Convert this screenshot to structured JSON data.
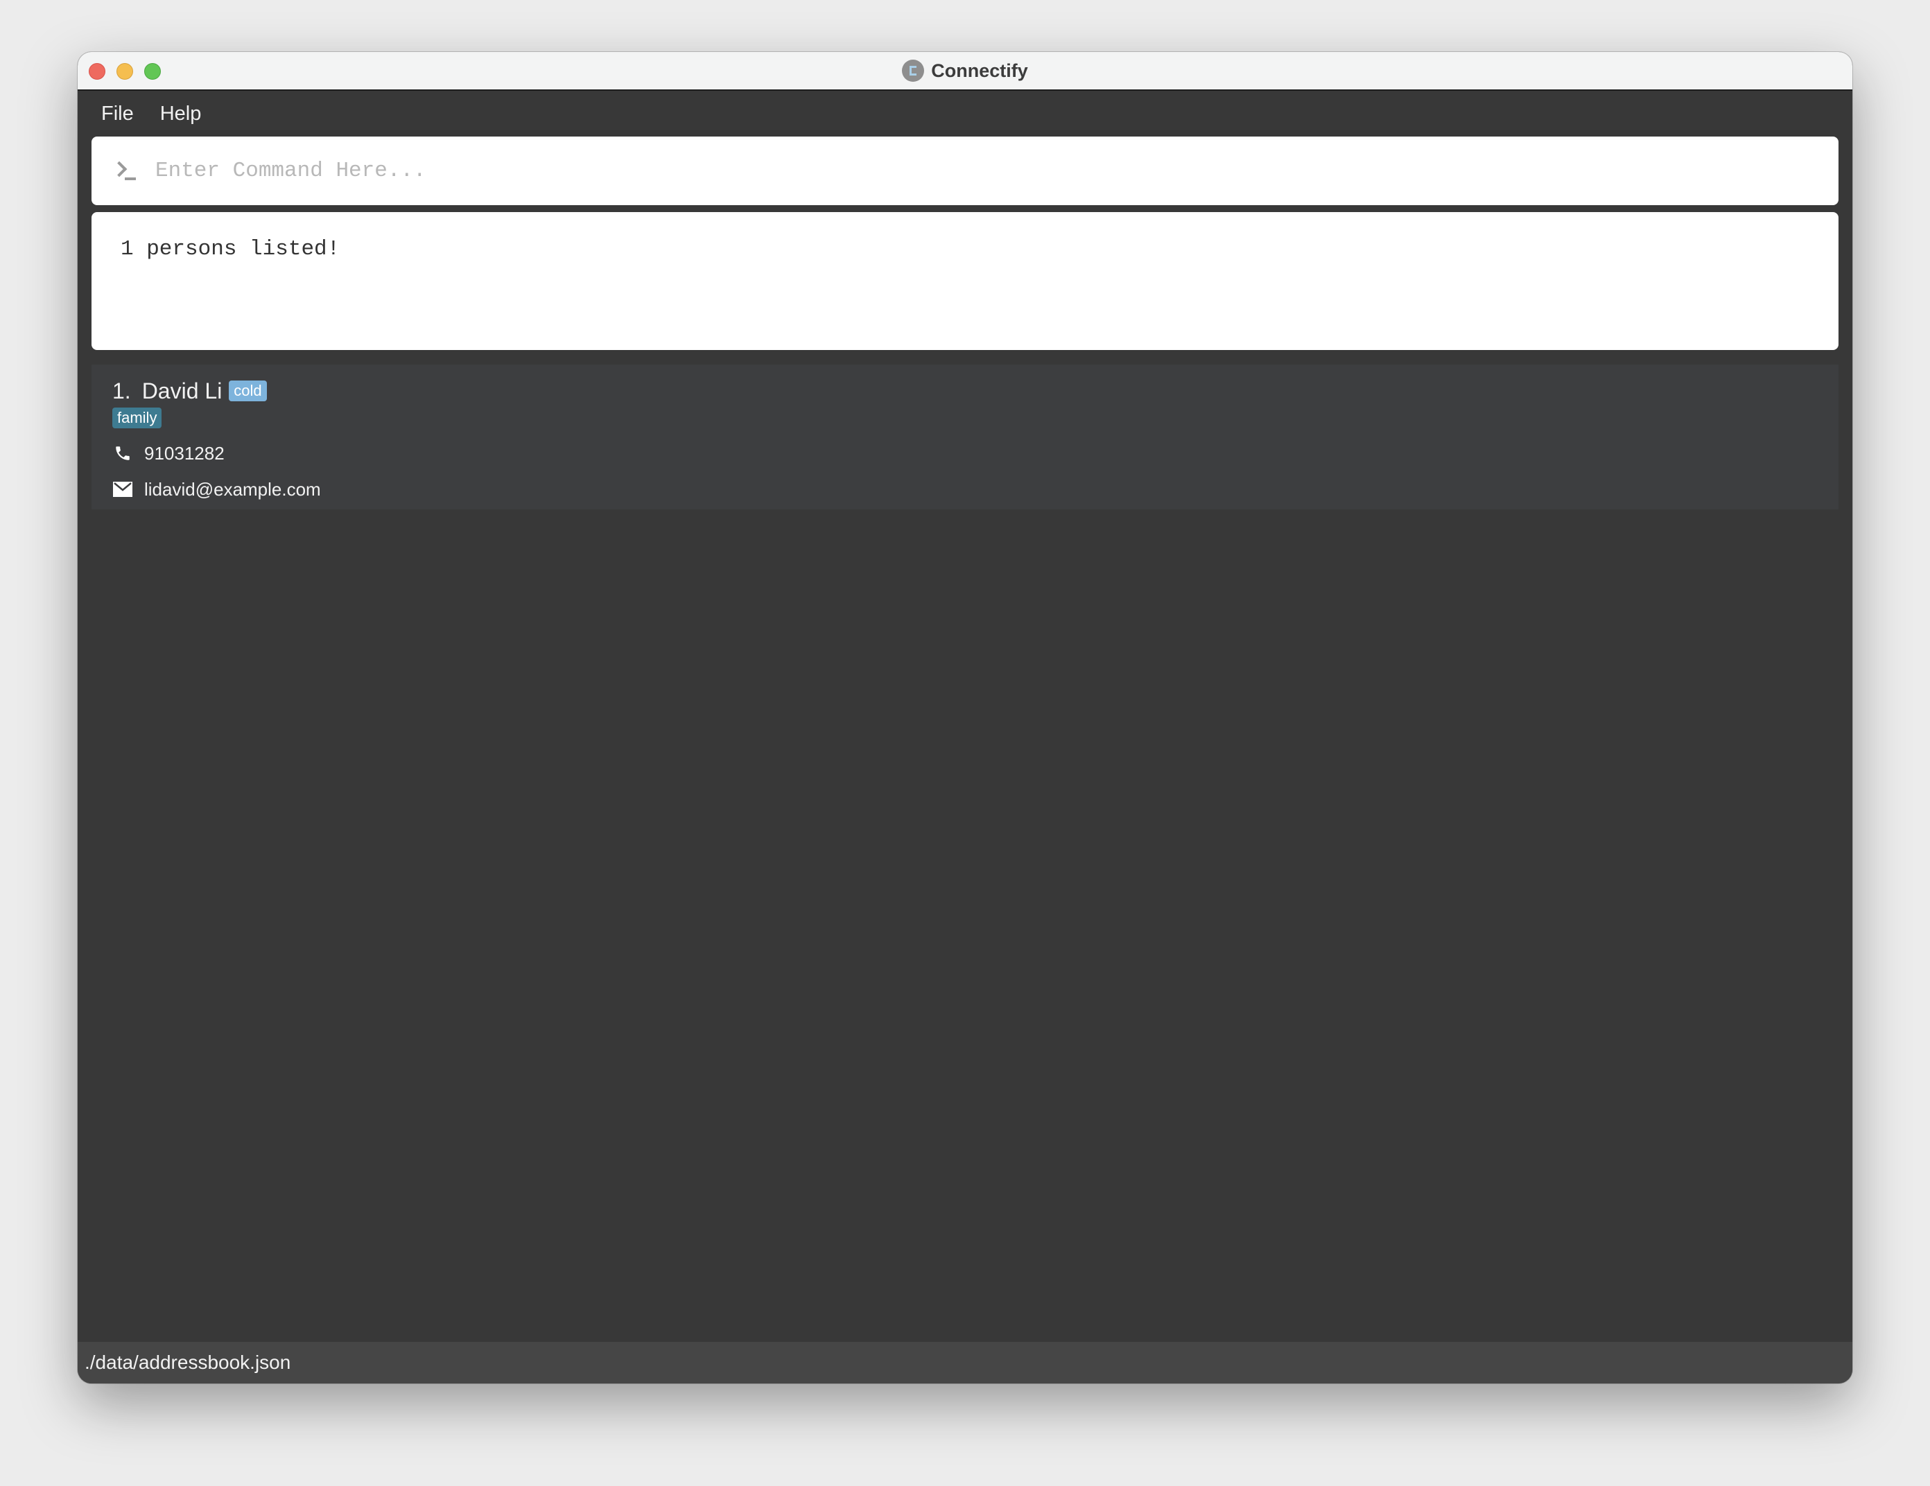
{
  "window": {
    "title": "Connectify",
    "app_icon": "connectify-logo-icon",
    "controls": [
      "close",
      "minimize",
      "maximize"
    ]
  },
  "menu": {
    "items": [
      {
        "label": "File"
      },
      {
        "label": "Help"
      }
    ]
  },
  "command": {
    "icon": "terminal-prompt-icon",
    "value": "",
    "placeholder": "Enter Command Here..."
  },
  "result": {
    "message": "1 persons listed!"
  },
  "persons": [
    {
      "index": "1.",
      "name": "David Li",
      "inline_tags": [
        "cold"
      ],
      "tags": [
        "family"
      ],
      "phone": "91031282",
      "email": "lidavid@example.com"
    }
  ],
  "colors": {
    "tag_cold": "#7db3dc",
    "tag_family": "#3e7b91",
    "background": "#383838",
    "card": "#3d3e40"
  },
  "status": {
    "file_path": "./data/addressbook.json"
  }
}
